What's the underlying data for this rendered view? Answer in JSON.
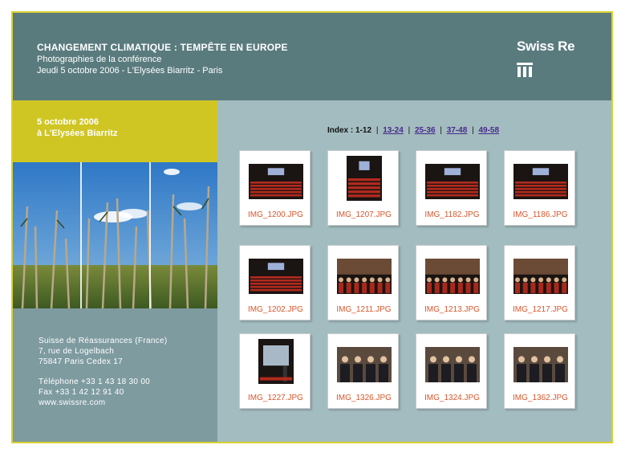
{
  "header": {
    "title": "CHANGEMENT CLIMATIQUE : TEMPÊTE EN EUROPE",
    "subtitle": "Photographies de la  conférence",
    "date_line": "Jeudi 5 octobre 2006 - L'Elysées Biarritz - Paris",
    "brand": "Swiss Re"
  },
  "event": {
    "date": "5 octobre 2006",
    "place": "à L'Elysées Biarritz"
  },
  "address": {
    "lines": [
      "Suisse de Réassurances (France)",
      "7, rue de Logelbach",
      "75847 Paris Cedex 17",
      "Téléphone +33 1 43 18 30 00",
      "Fax +33 1 42 12 91 40",
      "www.swissre.com"
    ]
  },
  "index": {
    "label": "Index :",
    "current": "1-12",
    "links": [
      "13-24",
      "25-36",
      "37-48",
      "49-58"
    ],
    "separator": "|"
  },
  "thumbnails": [
    {
      "file": "IMG_1200.JPG",
      "kind": "auditorium"
    },
    {
      "file": "IMG_1207.JPG",
      "kind": "auditorium-portrait"
    },
    {
      "file": "IMG_1182.JPG",
      "kind": "auditorium"
    },
    {
      "file": "IMG_1186.JPG",
      "kind": "auditorium"
    },
    {
      "file": "IMG_1202.JPG",
      "kind": "seats"
    },
    {
      "file": "IMG_1211.JPG",
      "kind": "audience"
    },
    {
      "file": "IMG_1213.JPG",
      "kind": "audience"
    },
    {
      "file": "IMG_1217.JPG",
      "kind": "audience"
    },
    {
      "file": "IMG_1227.JPG",
      "kind": "speaker-portrait"
    },
    {
      "file": "IMG_1326.JPG",
      "kind": "people"
    },
    {
      "file": "IMG_1324.JPG",
      "kind": "people"
    },
    {
      "file": "IMG_1362.JPG",
      "kind": "people"
    }
  ],
  "colors": {
    "header_bg": "#5a7b7e",
    "main_bg": "#a3bcbf",
    "event_bg": "#cfc623",
    "address_bg": "#7e9ba0",
    "border": "#d8d030",
    "caption": "#d9562c",
    "link": "#4a2a8c"
  }
}
